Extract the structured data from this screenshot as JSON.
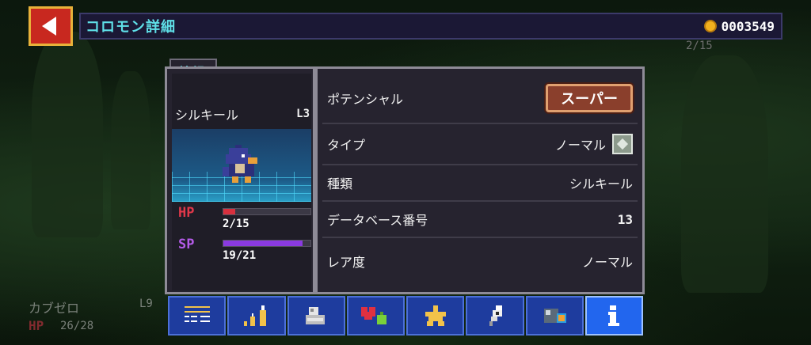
{
  "header": {
    "title": "コロモン詳細",
    "coins": "0003549",
    "back_icon": "back-arrow-icon"
  },
  "background": {
    "hp_text": "2/15",
    "card_name": "カブゼロ",
    "card_level": "L9",
    "card_hp_label": "HP",
    "card_hp_value": "26/28"
  },
  "panel": {
    "tab_label": "情報",
    "monster": {
      "name": "シルキール",
      "level": "L3",
      "hp_label": "HP",
      "hp_value": "2/15",
      "hp_fraction": 0.133,
      "sp_label": "SP",
      "sp_value": "19/21",
      "sp_fraction": 0.905
    },
    "rows": [
      {
        "label": "ポテンシャル",
        "value": "スーパー"
      },
      {
        "label": "タイプ",
        "value": "ノーマル"
      },
      {
        "label": "種類",
        "value": "シルキール"
      },
      {
        "label": "データベース番号",
        "value": "13"
      },
      {
        "label": "レア度",
        "value": "ノーマル"
      }
    ]
  },
  "tabs": [
    {
      "icon": "list-icon",
      "active": false
    },
    {
      "icon": "level-up-icon",
      "active": false
    },
    {
      "icon": "arm-strength-icon",
      "active": false
    },
    {
      "icon": "heart-potion-icon",
      "active": false
    },
    {
      "icon": "star-icon",
      "active": false
    },
    {
      "icon": "feather-icon",
      "active": false
    },
    {
      "icon": "orb-icon",
      "active": false
    },
    {
      "icon": "info-icon",
      "active": true
    }
  ],
  "colors": {
    "accent_cyan": "#5fe0e8",
    "hp_red": "#d8303e",
    "sp_purple": "#8a3ae0",
    "tab_blue": "#1e3c9e",
    "tab_active": "#2266ee"
  }
}
